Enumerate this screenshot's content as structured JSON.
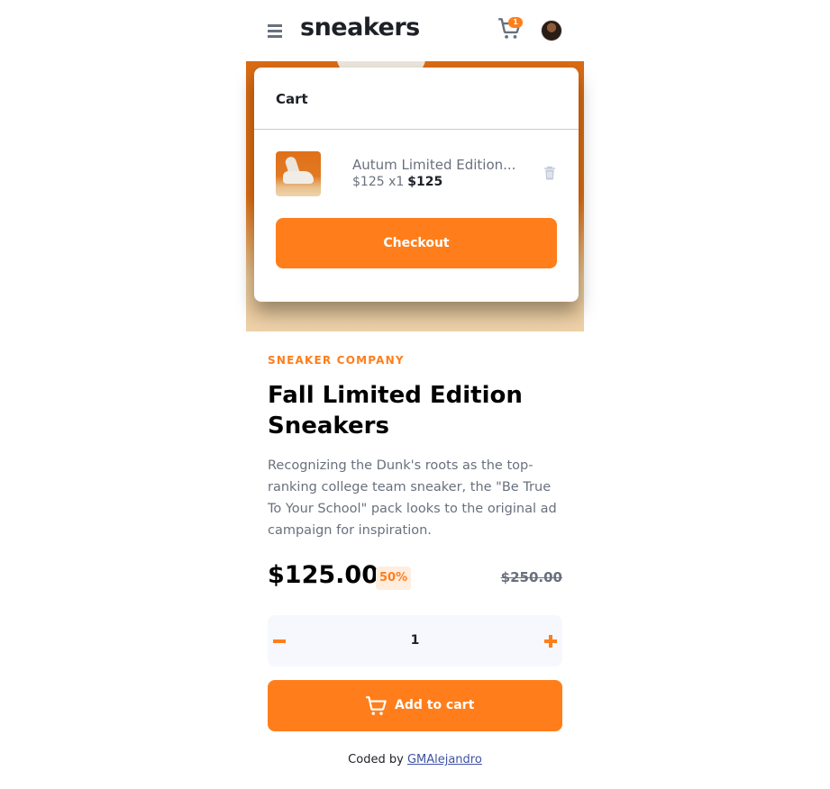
{
  "header": {
    "logo": "sneakers",
    "cart_count": "1",
    "icons": {
      "menu": "menu-icon",
      "cart": "cart-icon",
      "avatar": "avatar"
    }
  },
  "cart": {
    "title": "Cart",
    "item": {
      "name": "Autum Limited Edition...",
      "unit_price_qty": "$125 x1",
      "total": "$125"
    },
    "checkout_label": "Checkout"
  },
  "product": {
    "company": "SNEAKER COMPANY",
    "title": "Fall Limited Edition Sneakers",
    "description": "Recognizing the Dunk's roots as the top-ranking college team sneaker, the \"Be True To Your School\" pack looks to the original ad campaign for inspiration.",
    "price": "$125.00",
    "discount": "50%",
    "old_price": "$250.00"
  },
  "quantity": {
    "value": "1"
  },
  "add_to_cart_label": "Add to cart",
  "footer": {
    "prefix": "Coded by",
    "author": "GMAlejandro"
  },
  "colors": {
    "accent": "#ff7e1b",
    "accent_pale": "#ffeddf",
    "text_dark": "#1d2026",
    "text_gray": "#69707d",
    "qty_bg": "#f6f8fd"
  }
}
